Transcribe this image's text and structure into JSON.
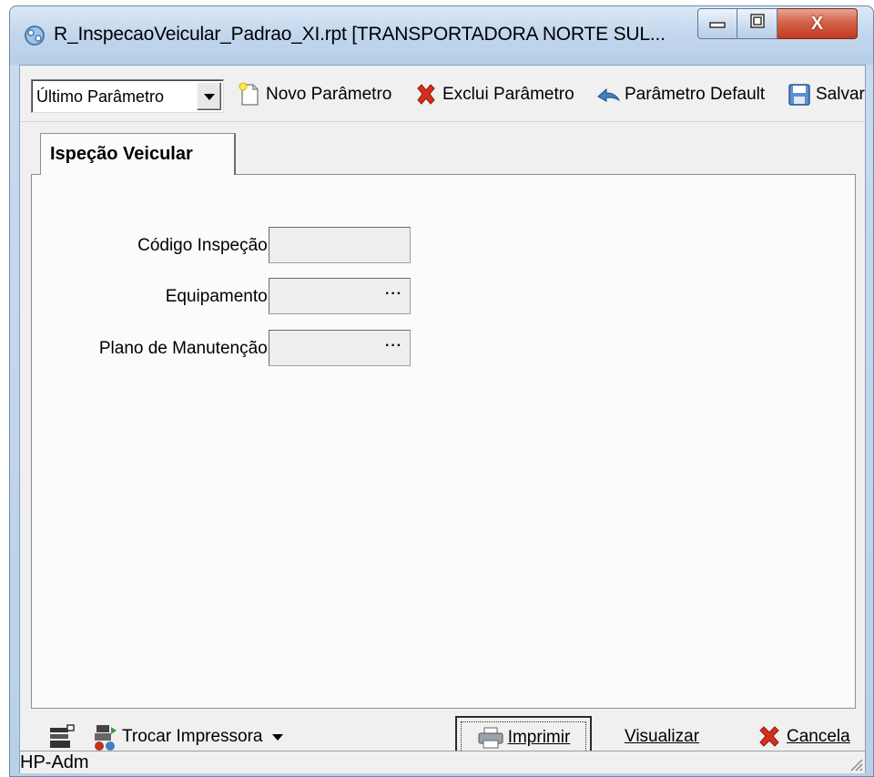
{
  "window": {
    "title": "R_InspecaoVeicular_Padrao_XI.rpt [TRANSPORTADORA NORTE SUL...",
    "close_label": "X"
  },
  "toolbar": {
    "parameter_select": {
      "selected": "Último Parâmetro"
    },
    "new_parameter_label": "Novo Parâmetro",
    "delete_parameter_label": "Exclui Parâmetro",
    "default_parameter_label": "Parâmetro Default",
    "save_label": "Salvar"
  },
  "tabs": [
    {
      "label": "Ispeção Veicular",
      "active": true
    }
  ],
  "form": {
    "fields": [
      {
        "label": "Código Inspeção:",
        "value": "",
        "has_lookup": false
      },
      {
        "label": "Equipamento:",
        "value": "",
        "has_lookup": true,
        "lookup_label": "···"
      },
      {
        "label": "Plano de Manutenção:",
        "value": "",
        "has_lookup": true,
        "lookup_label": "···"
      }
    ]
  },
  "bottom": {
    "change_printer_label": "Trocar Impressora",
    "print_label": "Imprimir",
    "preview_label": "Visualizar",
    "cancel_label": "Cancela"
  },
  "status": {
    "printer": "HP-Adm"
  },
  "icons": {
    "window": "report-icon",
    "new": "new-document-icon",
    "delete": "red-x-icon",
    "default": "undo-arrow-icon",
    "save": "floppy-disk-icon",
    "printer_setup": "printer-settings-icon",
    "swap_printer": "swap-printer-icon",
    "print": "printer-icon",
    "cancel": "red-x-icon"
  },
  "colors": {
    "close_button": "#c23a1f",
    "delete_icon": "#d6301a",
    "default_arrow": "#3f7fc4"
  }
}
